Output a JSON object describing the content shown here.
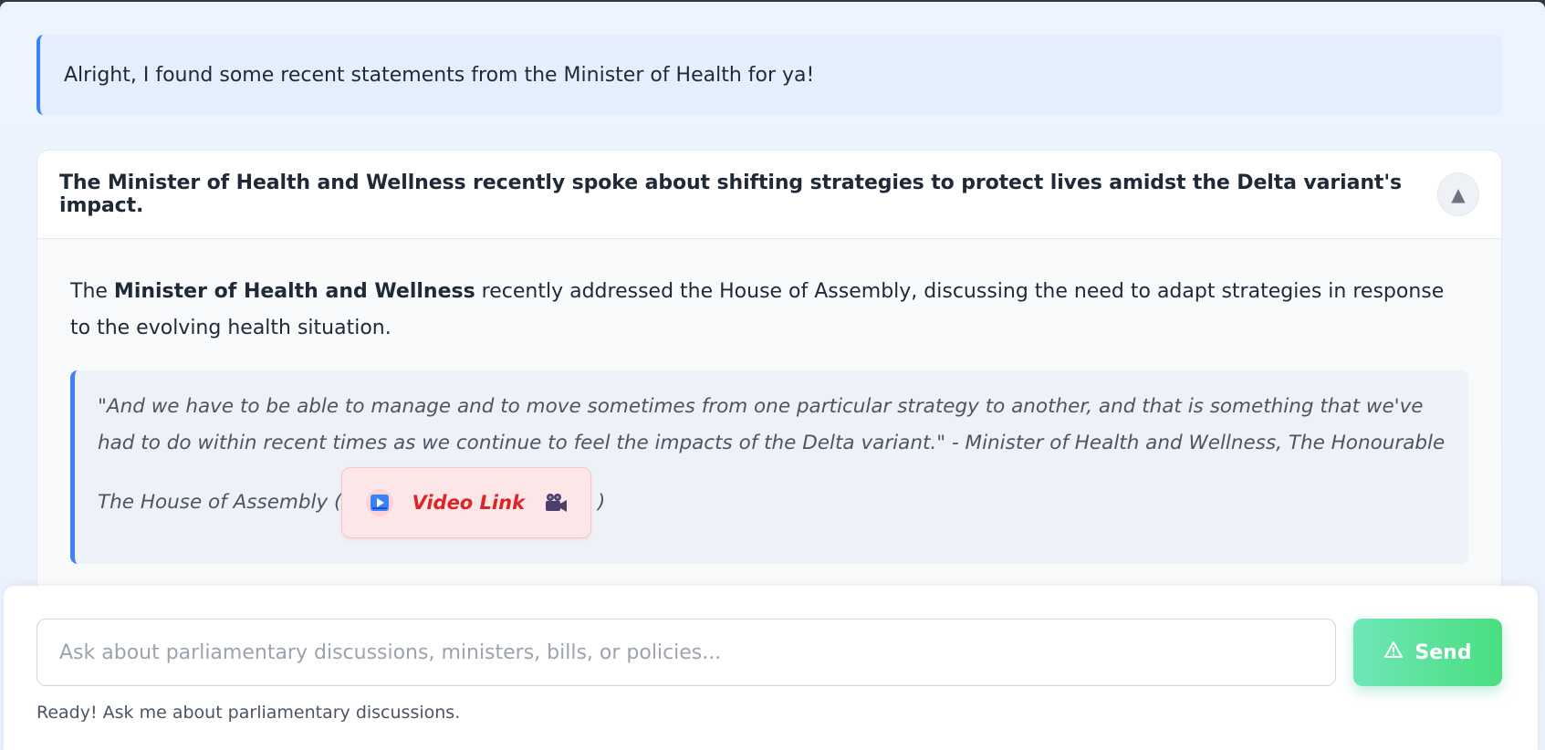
{
  "chat": {
    "bot_message": "Alright, I found some recent statements from the Minister of Health for ya!"
  },
  "result_card": {
    "title": "The Minister of Health and Wellness recently spoke about shifting strategies to protect lives amidst the Delta variant's impact.",
    "toggle_icon": "▲",
    "summary_prefix": "The ",
    "summary_bold": "Minister of Health and Wellness",
    "summary_suffix": " recently addressed the House of Assembly, discussing the need to adapt strategies in response to the evolving health situation.",
    "quote_text": "\"And we have to be able to manage and to move sometimes from one particular strategy to another, and that is something that we've had to do within recent times as we continue to feel the impacts of the Delta variant.\" - Minister of Health and Wellness, The Honourable The House of Assembly (",
    "quote_close": " )",
    "video_link_label": "Video Link",
    "video_link_icon": "play-icon",
    "video_camera_icon": "movie-camera-icon"
  },
  "composer": {
    "placeholder": "Ask about parliamentary discussions, ministers, bills, or policies...",
    "value": "",
    "send_label": "Send",
    "send_icon": "warning-triangle-icon",
    "status": "Ready! Ask me about parliamentary discussions."
  },
  "colors": {
    "accent_blue": "#3b82f6",
    "send_green": "#4ade80",
    "link_red": "#dc2626"
  }
}
